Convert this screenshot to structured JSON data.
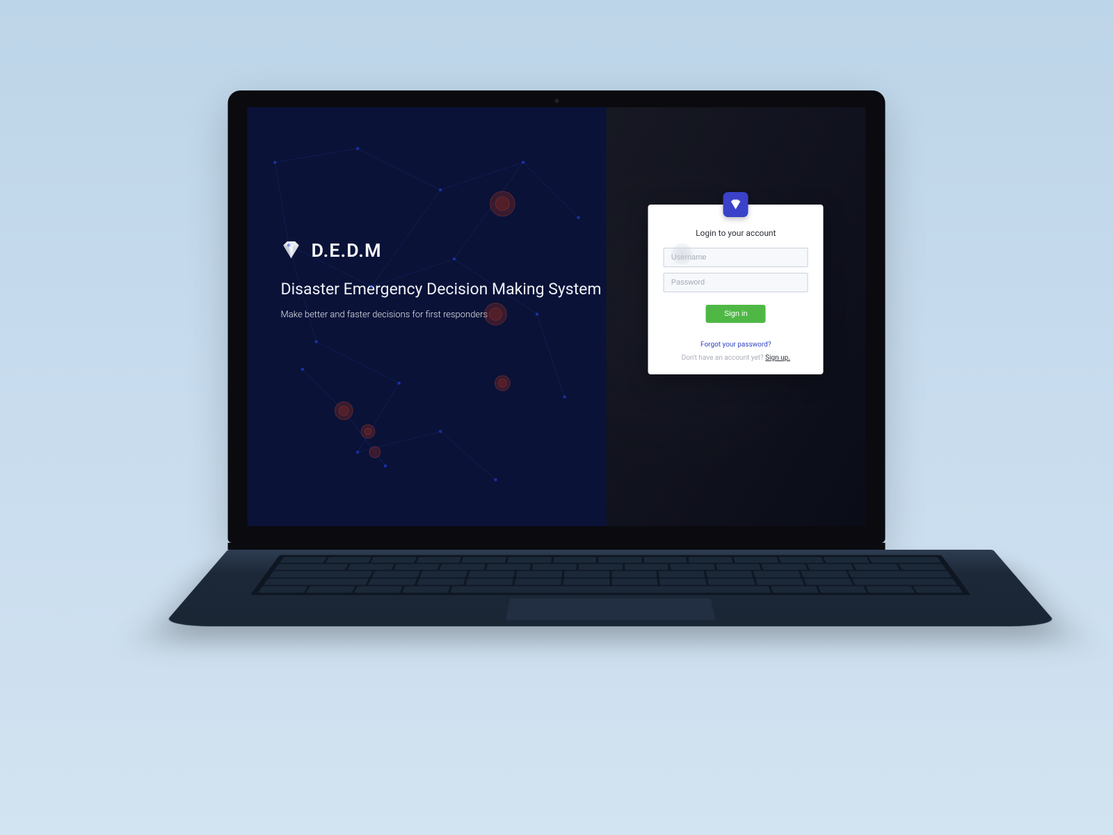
{
  "brand": {
    "name": "D.E.D.M",
    "headline": "Disaster Emergency Decision Making System",
    "tagline": "Make better and faster decisions for first responders"
  },
  "login": {
    "title": "Login to your account",
    "username_placeholder": "Username",
    "password_placeholder": "Password",
    "signin_label": "Sign in",
    "forgot_label": "Forgot your password?",
    "signup_prompt": "Don't have an account yet? ",
    "signup_link": "Sign up."
  },
  "colors": {
    "accent_blue": "#3942c8",
    "dark_bg": "#0a1238",
    "button_green": "#4fb845"
  }
}
